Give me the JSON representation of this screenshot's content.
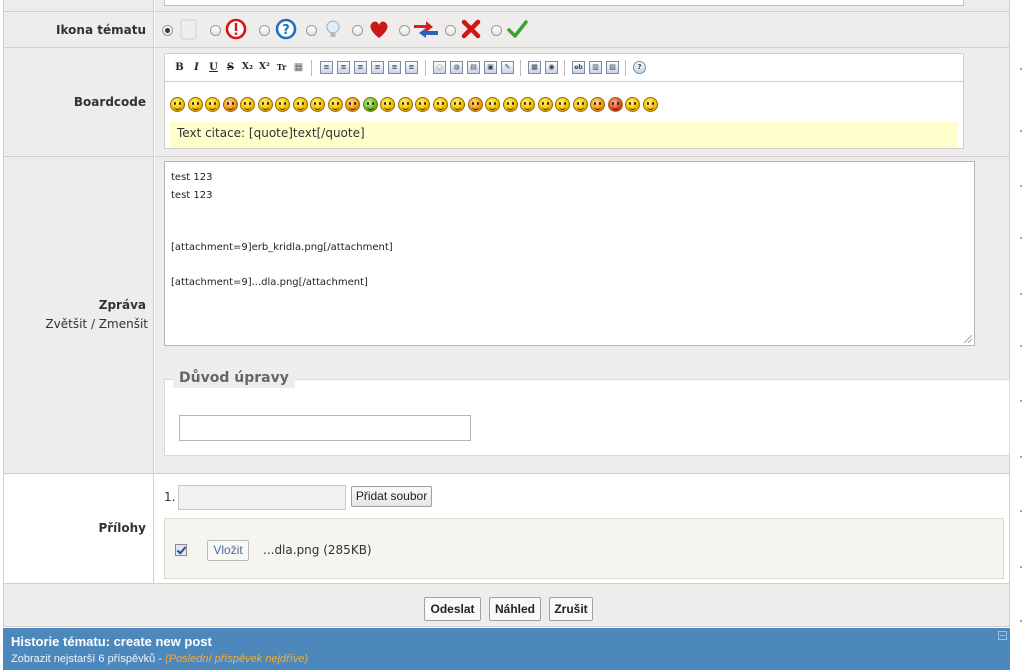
{
  "labels": {
    "topic_icon": "Ikona tématu",
    "boardcode": "Boardcode",
    "message": "Zpráva",
    "enlarge": "Zvětšit",
    "shrink": "Zmenšit",
    "zoom_sep": " / ",
    "attachments": "Přílohy"
  },
  "topic_icons": [
    "blank-icon",
    "exclamation-icon",
    "question-icon",
    "lightbulb-icon",
    "heart-icon",
    "arrows-icon",
    "red-x-icon",
    "checkmark-icon"
  ],
  "topic_icon_selected": 0,
  "boardcode": {
    "toolbar": [
      "B",
      "I",
      "U",
      "S",
      "X₂",
      "X²",
      "Tr",
      "▦"
    ],
    "quote_hint": "Text citace: [quote]text[/quote]",
    "smiley_count": 28
  },
  "message": {
    "text": "test 123\ntest 123\n\n\n[attachment=9]erb_kridla.png[/attachment]\n\n[attachment=9]...dla.png[/attachment]"
  },
  "edit_reason": {
    "legend": "Důvod úpravy",
    "value": ""
  },
  "attachments": {
    "index": "1.",
    "add_label": "Přidat soubor",
    "insert_label": "Vložit",
    "file_name": "...dla.png",
    "file_size": "(285KB)"
  },
  "buttons": {
    "submit": "Odeslat",
    "preview": "Náhled",
    "cancel": "Zrušit"
  },
  "history": {
    "title": "Historie tématu: create new post",
    "show_oldest": "Zobrazit nejstarší 6 příspěvků - ",
    "latest_first": "(Poslední příspěvek nejdříve)"
  },
  "colors": {
    "label_bg": "#efedeb",
    "history_bg": "#4d88bd",
    "hint_bg": "#ffffcc",
    "link_orange": "#f6ad2f"
  }
}
